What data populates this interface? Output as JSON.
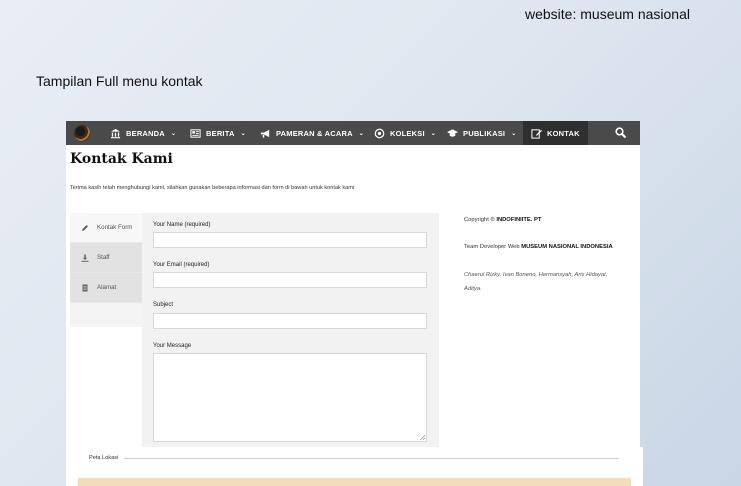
{
  "slide": {
    "site_text": "website: museum nasional",
    "caption": "Tampilan Full menu kontak"
  },
  "nav": {
    "logo_icon": "museum-logo",
    "items": [
      {
        "label": "BERANDA",
        "icon": "building-icon",
        "dropdown": true
      },
      {
        "label": "BERITA",
        "icon": "newspaper-icon",
        "dropdown": true
      },
      {
        "label": "PAMERAN & ACARA",
        "icon": "megaphone-icon",
        "dropdown": true
      },
      {
        "label": "KOLEKSI",
        "icon": "circle-target-icon",
        "dropdown": true
      },
      {
        "label": "PUBLIKASI",
        "icon": "graduation-cap-icon",
        "dropdown": true
      },
      {
        "label": "KONTAK",
        "icon": "edit-icon",
        "dropdown": false,
        "active": true
      }
    ],
    "search_icon": "search-icon",
    "bg_color": "#4a4a4a"
  },
  "page": {
    "title": "Kontak Kami",
    "intro": "Terima kasih telah menghubungi kami, silahkan gunakan beberapa informasi dan form di bawah untuk kontak kami"
  },
  "tabs": [
    {
      "label": "Kontak Form",
      "icon": "pencil-icon",
      "active": true
    },
    {
      "label": "Staff",
      "icon": "download-icon",
      "active": false
    },
    {
      "label": "Alamat",
      "icon": "document-icon",
      "active": false
    }
  ],
  "form": {
    "name_label": "Your Name (required)",
    "name_value": "",
    "email_label": "Your Email (required)",
    "email_value": "",
    "subject_label": "Subject",
    "subject_value": "",
    "message_label": "Your Message",
    "message_value": ""
  },
  "info": {
    "copyright_prefix": "Copyright ®",
    "copyright_company": "INDOFINIITE. PT",
    "team_prefix": "Team Developer Web",
    "team_org": "MUSEUM NASIONAL INDONESIA",
    "credits_line1": "Chaerul Rizky, Ivan Boneno, Hermansyah, Aris Hidayat,",
    "credits_line2": "Aditya."
  },
  "map": {
    "label": "Peta Lokasi",
    "bar_color": "#f2ddb9"
  }
}
